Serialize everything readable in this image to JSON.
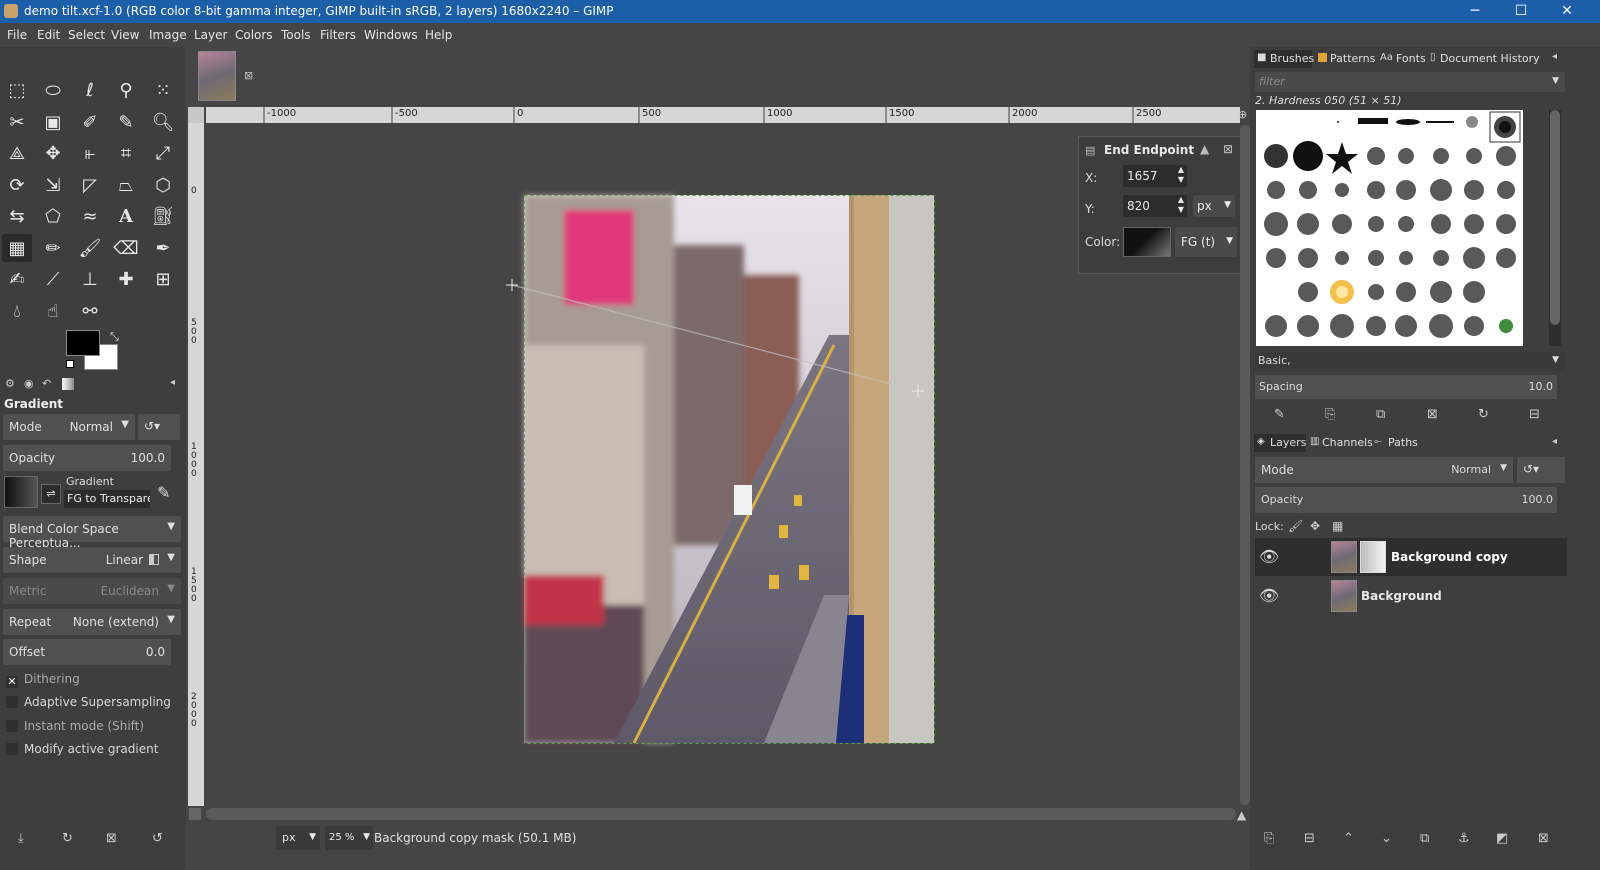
{
  "window": {
    "title": "demo tilt.xcf-1.0 (RGB color 8-bit gamma integer, GIMP built-in sRGB, 2 layers) 1680x2240 – GIMP",
    "minimize": "─",
    "maximize": "☐",
    "close": "✕"
  },
  "menu": [
    "File",
    "Edit",
    "Select",
    "View",
    "Image",
    "Layer",
    "Colors",
    "Tools",
    "Filters",
    "Windows",
    "Help"
  ],
  "tool_options": {
    "title": "Gradient",
    "mode_label": "Mode",
    "mode_value": "Normal",
    "opacity_label": "Opacity",
    "opacity_value": "100.0",
    "gradient_label": "Gradient",
    "gradient_value": "FG to Transparer",
    "blend_space": "Blend Color Space Perceptua...",
    "shape_label": "Shape",
    "shape_value": "Linear",
    "metric_label": "Metric",
    "metric_value": "Euclidean",
    "repeat_label": "Repeat",
    "repeat_value": "None (extend)",
    "offset_label": "Offset",
    "offset_value": "0.0",
    "dithering": "Dithering",
    "adaptive": "Adaptive Supersampling",
    "instant": "Instant mode  (Shift)",
    "modify": "Modify active gradient"
  },
  "ruler_h": [
    "-1000",
    "-500",
    "0",
    "500",
    "1000",
    "1500",
    "2000",
    "2500"
  ],
  "ruler_v": [
    "0",
    "5\n0\n0",
    "1\n0\n0\n0",
    "1\n5\n0\n0",
    "2\n0\n0\n0"
  ],
  "endpoint_dialog": {
    "title": "End Endpoint",
    "x_label": "X:",
    "x_value": "1657",
    "y_label": "Y:",
    "y_value": "820",
    "unit": "px",
    "color_label": "Color:",
    "color_value": "FG (t)"
  },
  "statusbar": {
    "unit": "px",
    "zoom": "25 %",
    "message": "Background copy mask (50.1 MB)"
  },
  "brushes_panel": {
    "tabs": [
      "Brushes",
      "Patterns",
      "Fonts",
      "Document History"
    ],
    "filter_placeholder": "filter",
    "selected_brush": "2. Hardness 050 (51 × 51)",
    "tag": "Basic,",
    "spacing_label": "Spacing",
    "spacing_value": "10.0"
  },
  "layers_panel": {
    "tabs": [
      "Layers",
      "Channels",
      "Paths"
    ],
    "mode_label": "Mode",
    "mode_value": "Normal",
    "opacity_label": "Opacity",
    "opacity_value": "100.0",
    "lock_label": "Lock:",
    "layers": [
      {
        "name": "Background copy",
        "selected": true
      },
      {
        "name": "Background",
        "selected": false
      }
    ]
  }
}
